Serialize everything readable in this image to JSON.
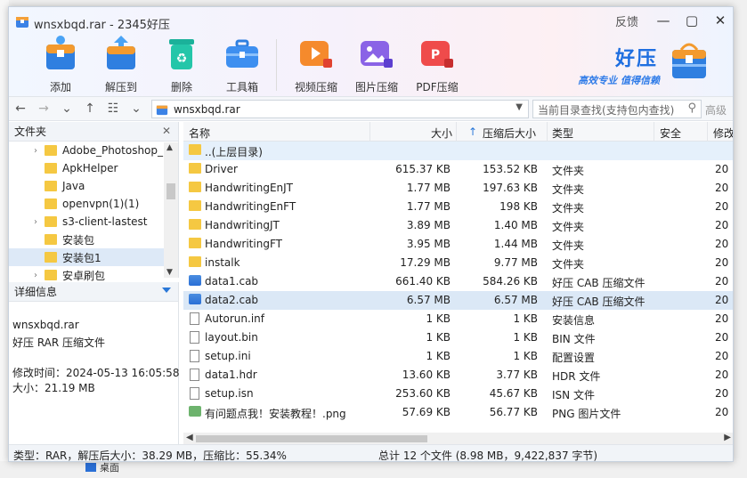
{
  "background": {
    "desktop_label": "桌面"
  },
  "window": {
    "title": "wnsxbqd.rar - 2345好压",
    "feedback": "反馈",
    "minimize": "—",
    "maximize": "▢",
    "close": "✕"
  },
  "toolbar": {
    "add": "添加",
    "extract_to": "解压到",
    "delete": "删除",
    "toolbox": "工具箱",
    "video_compress": "视频压缩",
    "image_compress": "图片压缩",
    "pdf_compress": "PDF压缩"
  },
  "brand": {
    "name": "好压",
    "slogan": "高效专业  值得信赖"
  },
  "addressbar": {
    "path": "wnsxbqd.rar",
    "search_placeholder": "当前目录查找(支持包内查找)",
    "advanced": "高级"
  },
  "folders_pane": {
    "title": "文件夹",
    "items": [
      {
        "label": "Adobe_Photoshop_",
        "expandable": true
      },
      {
        "label": "ApkHelper",
        "expandable": false
      },
      {
        "label": "Java",
        "expandable": false
      },
      {
        "label": "openvpn(1)(1)",
        "expandable": false
      },
      {
        "label": "s3-client-lastest",
        "expandable": true
      },
      {
        "label": "安装包",
        "expandable": false
      },
      {
        "label": "安装包1",
        "expandable": false,
        "selected": true
      },
      {
        "label": "安卓刷包",
        "expandable": true
      }
    ]
  },
  "details_pane": {
    "title": "详细信息",
    "filename": "wnsxbqd.rar",
    "filetype": "好压 RAR 压缩文件",
    "modified": "修改时间：2024-05-13 16:05:58",
    "size": "大小：21.19 MB"
  },
  "file_list": {
    "columns": [
      "名称",
      "大小",
      "压缩后大小",
      "类型",
      "安全",
      "修改"
    ],
    "sort_indicator": "↑",
    "rows": [
      {
        "icon": "folder",
        "name": "..(上层目录)",
        "size": "",
        "packed": "",
        "type": "",
        "date": ""
      },
      {
        "icon": "folder",
        "name": "Driver",
        "size": "615.37 KB",
        "packed": "153.52 KB",
        "type": "文件夹",
        "date": "20"
      },
      {
        "icon": "folder",
        "name": "HandwritingEnJT",
        "size": "1.77 MB",
        "packed": "197.63 KB",
        "type": "文件夹",
        "date": "20"
      },
      {
        "icon": "folder",
        "name": "HandwritingEnFT",
        "size": "1.77 MB",
        "packed": "198 KB",
        "type": "文件夹",
        "date": "20"
      },
      {
        "icon": "folder",
        "name": "HandwritingJT",
        "size": "3.89 MB",
        "packed": "1.40 MB",
        "type": "文件夹",
        "date": "20"
      },
      {
        "icon": "folder",
        "name": "HandwritingFT",
        "size": "3.95 MB",
        "packed": "1.44 MB",
        "type": "文件夹",
        "date": "20"
      },
      {
        "icon": "folder",
        "name": "instalk",
        "size": "17.29 MB",
        "packed": "9.77 MB",
        "type": "文件夹",
        "date": "20"
      },
      {
        "icon": "cab",
        "name": "data1.cab",
        "size": "661.40 KB",
        "packed": "584.26 KB",
        "type": "好压 CAB 压缩文件",
        "date": "20"
      },
      {
        "icon": "cab",
        "name": "data2.cab",
        "size": "6.57 MB",
        "packed": "6.57 MB",
        "type": "好压 CAB 压缩文件",
        "date": "20"
      },
      {
        "icon": "file",
        "name": "Autorun.inf",
        "size": "1 KB",
        "packed": "1 KB",
        "type": "安装信息",
        "date": "20"
      },
      {
        "icon": "file",
        "name": "layout.bin",
        "size": "1 KB",
        "packed": "1 KB",
        "type": "BIN 文件",
        "date": "20"
      },
      {
        "icon": "file",
        "name": "setup.ini",
        "size": "1 KB",
        "packed": "1 KB",
        "type": "配置设置",
        "date": "20"
      },
      {
        "icon": "file",
        "name": "data1.hdr",
        "size": "13.60 KB",
        "packed": "3.77 KB",
        "type": "HDR 文件",
        "date": "20"
      },
      {
        "icon": "file",
        "name": "setup.isn",
        "size": "253.60 KB",
        "packed": "45.67 KB",
        "type": "ISN 文件",
        "date": "20"
      },
      {
        "icon": "png",
        "name": "有问题点我！安装教程！.png",
        "size": "57.69 KB",
        "packed": "56.77 KB",
        "type": "PNG 图片文件",
        "date": "20"
      }
    ]
  },
  "status": {
    "left": "类型：RAR，解压后大小：38.29 MB，压缩比：55.34%",
    "right": "总计 12 个文件 (8.98 MB，9,422,837 字节)"
  }
}
